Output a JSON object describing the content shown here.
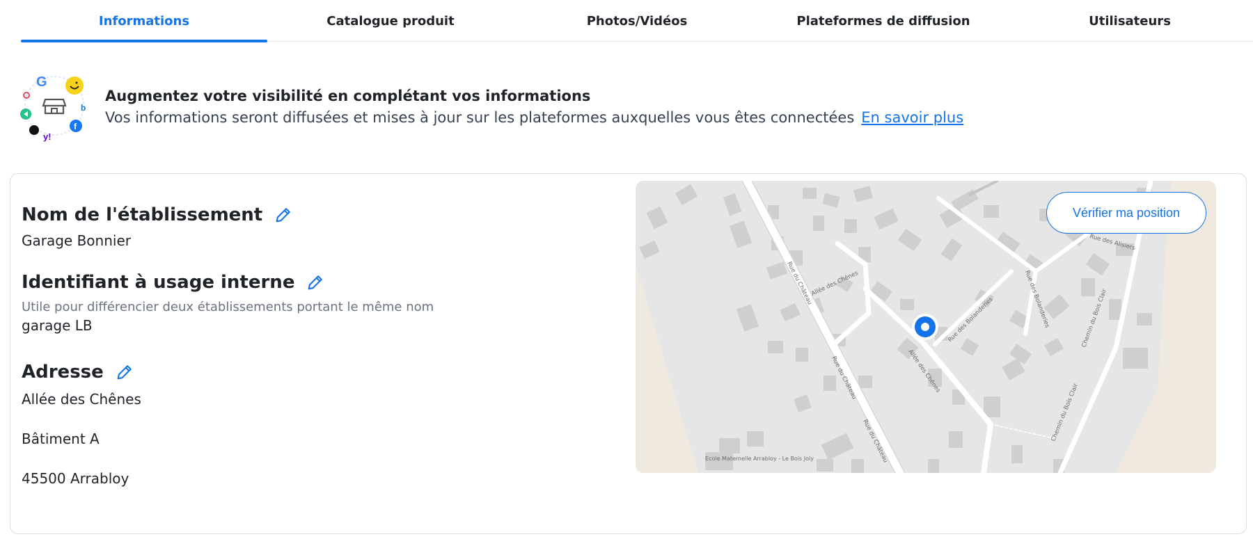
{
  "tabs": [
    {
      "label": "Informations",
      "active": true
    },
    {
      "label": "Catalogue produit"
    },
    {
      "label": "Photos/Vidéos"
    },
    {
      "label": "Plateformes de diffusion"
    },
    {
      "label": "Utilisateurs"
    }
  ],
  "banner": {
    "title": "Augmentez votre visibilité en complétant vos informations",
    "description": "Vos informations seront diffusées et mises à jour sur les plateformes auxquelles vous êtes connectées",
    "link_label": "En savoir plus",
    "logo_icons": [
      "google-icon",
      "smiley-icon",
      "store-icon",
      "facebook-icon",
      "bing-icon",
      "tripadvisor-icon",
      "yahoo-icon",
      "uber-icon",
      "waze-icon"
    ]
  },
  "establishment": {
    "name_title": "Nom de l'établissement",
    "name_value": "Garage Bonnier",
    "internal_title": "Identifiant à usage interne",
    "internal_hint": "Utile pour différencier deux établissements portant le même nom",
    "internal_value": "garage LB",
    "address_title": "Adresse",
    "address_lines": [
      "Allée des Chênes",
      "Bâtiment A",
      "45500 Arrabloy"
    ]
  },
  "map": {
    "verify_button": "Vérifier ma position",
    "street_labels": [
      "Rue du Château",
      "Rue du Château",
      "Rue du Château",
      "Allée des Chênes",
      "Allée des Chênes",
      "Rue des Bolanderies",
      "Rue des Bolanderies",
      "Chemin du Bois Clair",
      "Chemin du Bois Clair",
      "Rue des Alisiers",
      "Ecole Maternelle Arrabloy - Le Bois Joly"
    ]
  },
  "colors": {
    "accent": "#1473e6",
    "map_bg": "#e6e6e6",
    "road": "#ffffff",
    "building": "#cfcfcf",
    "field": "#efe9df"
  }
}
